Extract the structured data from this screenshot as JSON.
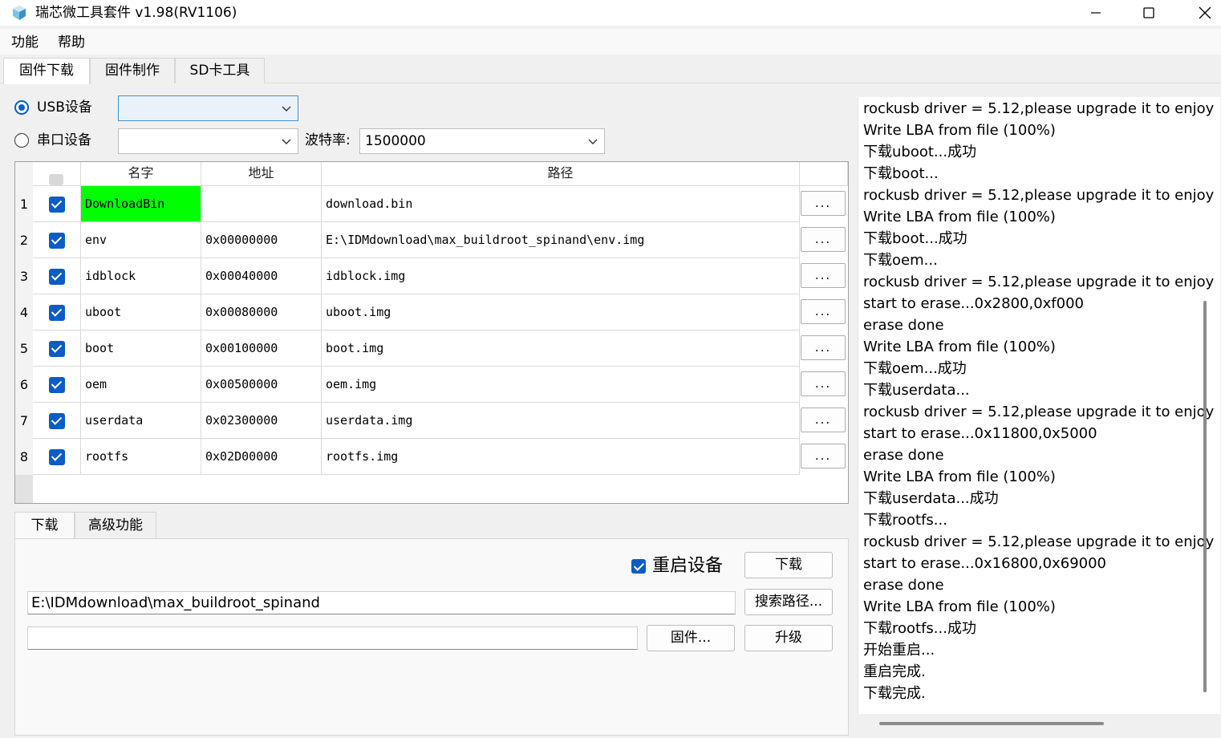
{
  "window": {
    "title": "瑞芯微工具套件 v1.98(RV1106)"
  },
  "menu": [
    "功能",
    "帮助"
  ],
  "tabs": [
    "固件下载",
    "固件制作",
    "SD卡工具"
  ],
  "device": {
    "usb_label": "USB设备",
    "usb_value": "",
    "serial_label": "串口设备",
    "serial_value": "",
    "baud_label": "波特率:",
    "baud_value": "1500000"
  },
  "table": {
    "headers": [
      "名字",
      "地址",
      "路径"
    ],
    "rows": [
      {
        "num": "1",
        "name": "DownloadBin",
        "addr": "",
        "path": "download.bin",
        "browse": "..."
      },
      {
        "num": "2",
        "name": "env",
        "addr": "0x00000000",
        "path": "E:\\IDMdownload\\max_buildroot_spinand\\env.img",
        "browse": "..."
      },
      {
        "num": "3",
        "name": "idblock",
        "addr": "0x00040000",
        "path": "idblock.img",
        "browse": "..."
      },
      {
        "num": "4",
        "name": "uboot",
        "addr": "0x00080000",
        "path": "uboot.img",
        "browse": "..."
      },
      {
        "num": "5",
        "name": "boot",
        "addr": "0x00100000",
        "path": "boot.img",
        "browse": "..."
      },
      {
        "num": "6",
        "name": "oem",
        "addr": "0x00500000",
        "path": "oem.img",
        "browse": "..."
      },
      {
        "num": "7",
        "name": "userdata",
        "addr": "0x02300000",
        "path": "userdata.img",
        "browse": "..."
      },
      {
        "num": "8",
        "name": "rootfs",
        "addr": "0x02D00000",
        "path": "rootfs.img",
        "browse": "..."
      }
    ]
  },
  "subtabs": [
    "下载",
    "高级功能"
  ],
  "download_panel": {
    "reboot_label": "重启设备",
    "download_button": "下载",
    "path_value": "E:\\IDMdownload\\max_buildroot_spinand",
    "search_path_button": "搜索路径...",
    "firmware_value": "",
    "firmware_button": "固件...",
    "upgrade_button": "升级"
  },
  "log": [
    "rockusb driver = 5.12,please upgrade it to enjoy",
    "Write LBA from file (100%)",
    "下载uboot...成功",
    "下载boot...",
    "rockusb driver = 5.12,please upgrade it to enjoy",
    "Write LBA from file (100%)",
    "下载boot...成功",
    "下载oem...",
    "rockusb driver = 5.12,please upgrade it to enjoy",
    "start to erase...0x2800,0xf000",
    "erase done",
    "Write LBA from file (100%)",
    "下载oem...成功",
    "下载userdata...",
    "rockusb driver = 5.12,please upgrade it to enjoy",
    "start to erase...0x11800,0x5000",
    "erase done",
    "Write LBA from file (100%)",
    "下载userdata...成功",
    "下载rootfs...",
    "rockusb driver = 5.12,please upgrade it to enjoy",
    "start to erase...0x16800,0x69000",
    "erase done",
    "Write LBA from file (100%)",
    "下载rootfs...成功",
    "开始重启...",
    "重启完成.",
    "下载完成."
  ],
  "colors": {
    "accent": "#0b5cc4",
    "highlight_cell": "#00ff00"
  }
}
